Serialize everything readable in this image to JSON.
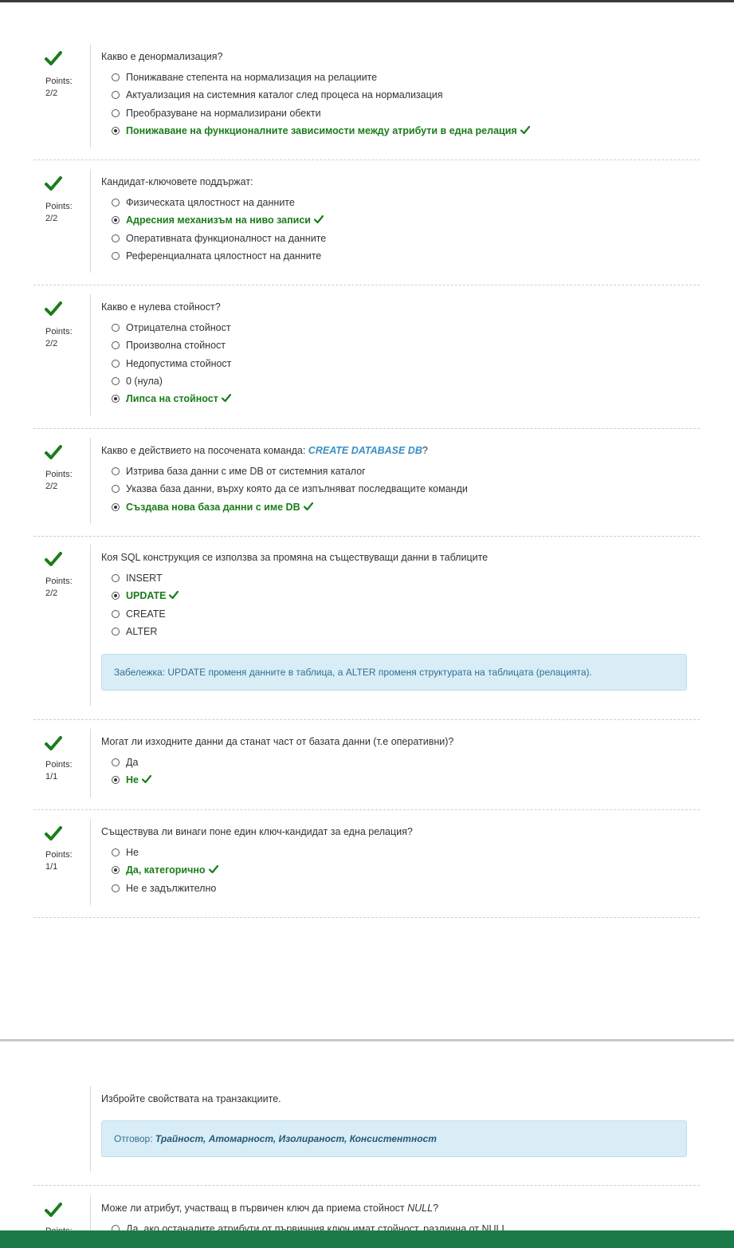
{
  "points_label": "Points:",
  "correct_icon": "checkmark-icon",
  "colors": {
    "correct": "#1a7d1a",
    "note_bg": "#d9edf7",
    "note_text": "#31708f",
    "code": "#3a8fc5",
    "bottom_bar": "#1c7a48"
  },
  "questions": [
    {
      "text": "Какво е денормализация?",
      "score": "2/2",
      "answers": [
        {
          "label": "Понижаване степента на нормализация на релациите",
          "selected": false,
          "correct": false
        },
        {
          "label": "Актуализация на системния каталог след процеса на нормализация",
          "selected": false,
          "correct": false
        },
        {
          "label": "Преобразуване на нормализирани обекти",
          "selected": false,
          "correct": false
        },
        {
          "label": "Понижаване на функционалните зависимости между атрибути в една релация",
          "selected": true,
          "correct": true
        }
      ]
    },
    {
      "text": "Кандидат-ключовете поддържат:",
      "score": "2/2",
      "answers": [
        {
          "label": "Физическата цялостност на данните",
          "selected": false,
          "correct": false
        },
        {
          "label": "Адресния механизъм на ниво записи",
          "selected": true,
          "correct": true
        },
        {
          "label": "Оперативната функционалност на данните",
          "selected": false,
          "correct": false
        },
        {
          "label": "Референциалната цялостност на данните",
          "selected": false,
          "correct": false
        }
      ]
    },
    {
      "text": "Какво е нулева стойност?",
      "score": "2/2",
      "answers": [
        {
          "label": "Отрицателна стойност",
          "selected": false,
          "correct": false
        },
        {
          "label": "Произволна стойност",
          "selected": false,
          "correct": false
        },
        {
          "label": "Недопустима стойност",
          "selected": false,
          "correct": false
        },
        {
          "label": "0 (нула)",
          "selected": false,
          "correct": false
        },
        {
          "label": "Липса на стойност",
          "selected": true,
          "correct": true
        }
      ]
    },
    {
      "text_prefix": "Какво е действието на посочената команда: ",
      "text_code": "CREATE DATABASE DB",
      "text_suffix": "?",
      "score": "2/2",
      "answers": [
        {
          "label": "Изтрива база данни с име DB от системния каталог",
          "selected": false,
          "correct": false
        },
        {
          "label": "Указва база данни, върху която да се изпълняват последващите команди",
          "selected": false,
          "correct": false
        },
        {
          "label": "Създава нова база данни с име DB",
          "selected": true,
          "correct": true
        }
      ]
    },
    {
      "text": "Коя SQL конструкция се използва за промяна на съществуващи данни в таблиците",
      "score": "2/2",
      "answers": [
        {
          "label": "INSERT",
          "selected": false,
          "correct": false
        },
        {
          "label": "UPDATE",
          "selected": true,
          "correct": true
        },
        {
          "label": "CREATE",
          "selected": false,
          "correct": false
        },
        {
          "label": "ALTER",
          "selected": false,
          "correct": false
        }
      ],
      "note": "Забележка: UPDATE променя данните в таблица, а ALTER променя структурата на таблицата (релацията)."
    },
    {
      "text": "Могат ли изходните данни да станат част от базата данни (т.е оперативни)?",
      "score": "1/1",
      "answers": [
        {
          "label": "Да",
          "selected": false,
          "correct": false
        },
        {
          "label": "Не",
          "selected": true,
          "correct": true
        }
      ]
    },
    {
      "text": "Съществува ли винаги поне един ключ-кандидат за една релация?",
      "score": "1/1",
      "answers": [
        {
          "label": "Не",
          "selected": false,
          "correct": false
        },
        {
          "label": "Да, категорично",
          "selected": true,
          "correct": true
        },
        {
          "label": "Не е задължително",
          "selected": false,
          "correct": false
        }
      ]
    }
  ],
  "open_question": {
    "text": "Избройте свойствата на транзакциите.",
    "answer_label": "Отговор: ",
    "answer_value": "Трайност, Атомарност, Изолираност, Консистентност"
  },
  "last_question": {
    "text_prefix": "Може ли атрибут, участващ в първичен ключ да приема стойност ",
    "text_null": "NULL",
    "text_suffix": "?",
    "points_label": "Points:",
    "first_answer": "Да, ако останалите атрибути от първичния ключ имат стойност, различна от NULL"
  }
}
